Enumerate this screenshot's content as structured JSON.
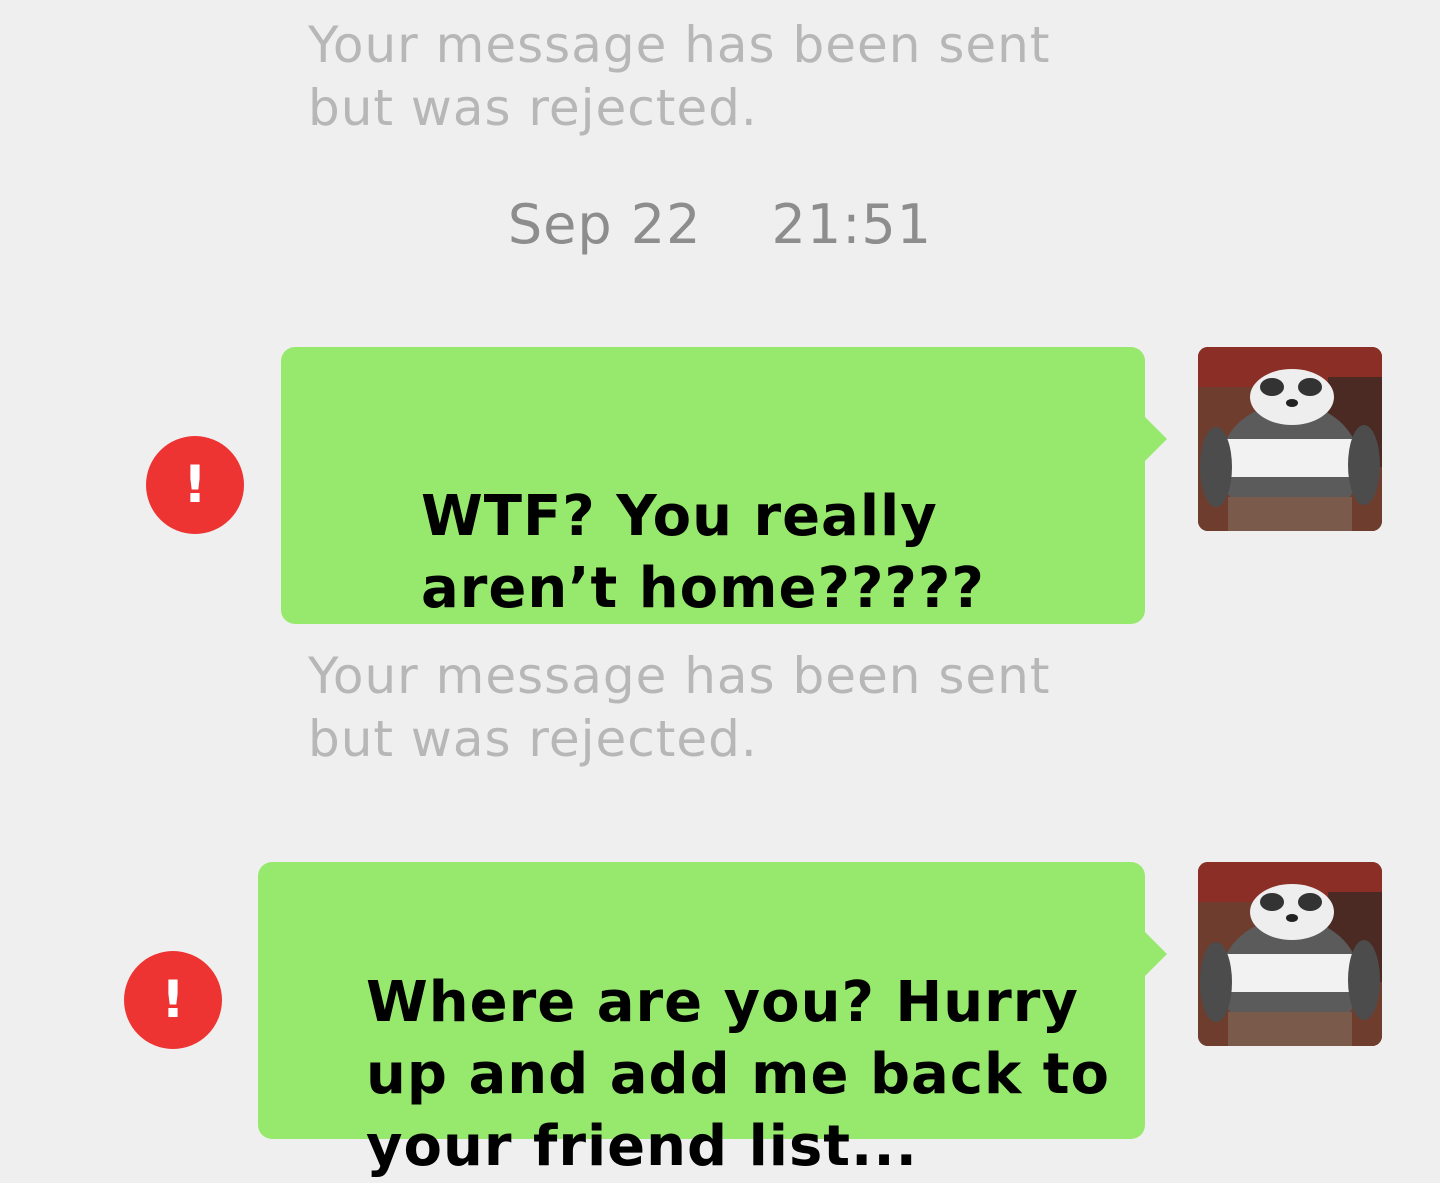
{
  "chat": {
    "system_note_1": "Your message has been sent\nbut was rejected.",
    "timestamp": {
      "date": "Sep 22",
      "time": "21:51"
    },
    "messages": [
      {
        "text": "WTF? You really\naren’t home?????",
        "error_icon": "!",
        "status_note": "Your message has been sent\nbut was rejected."
      },
      {
        "text": "Where are you? Hurry\nup and add me back to\nyour friend list...",
        "error_icon": "!"
      }
    ]
  },
  "colors": {
    "background": "#efefef",
    "bubble": "#97e96d",
    "error": "#ee3433",
    "system_text": "#b7b7b7",
    "timestamp_text": "#8d8d8d"
  },
  "icons": {
    "error": "exclamation-circle-icon",
    "avatar": "panda-avatar"
  }
}
